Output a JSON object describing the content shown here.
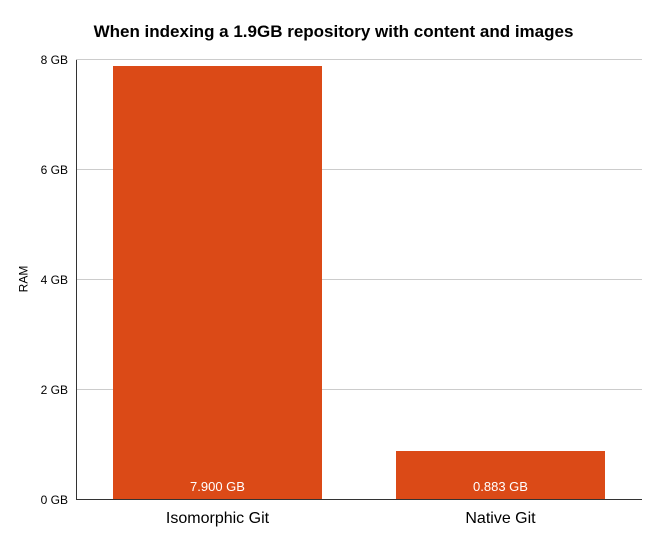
{
  "chart_data": {
    "type": "bar",
    "title": "When indexing a 1.9GB repository with content and images",
    "ylabel": "RAM",
    "xlabel": "",
    "ylim": [
      0,
      8
    ],
    "y_ticks": [
      "0 GB",
      "2 GB",
      "4 GB",
      "6 GB",
      "8 GB"
    ],
    "categories": [
      "Isomorphic Git",
      "Native Git"
    ],
    "values": [
      7.9,
      0.883
    ],
    "value_labels": [
      "7.900 GB",
      "0.883 GB"
    ],
    "bar_color": "#db4a17"
  }
}
